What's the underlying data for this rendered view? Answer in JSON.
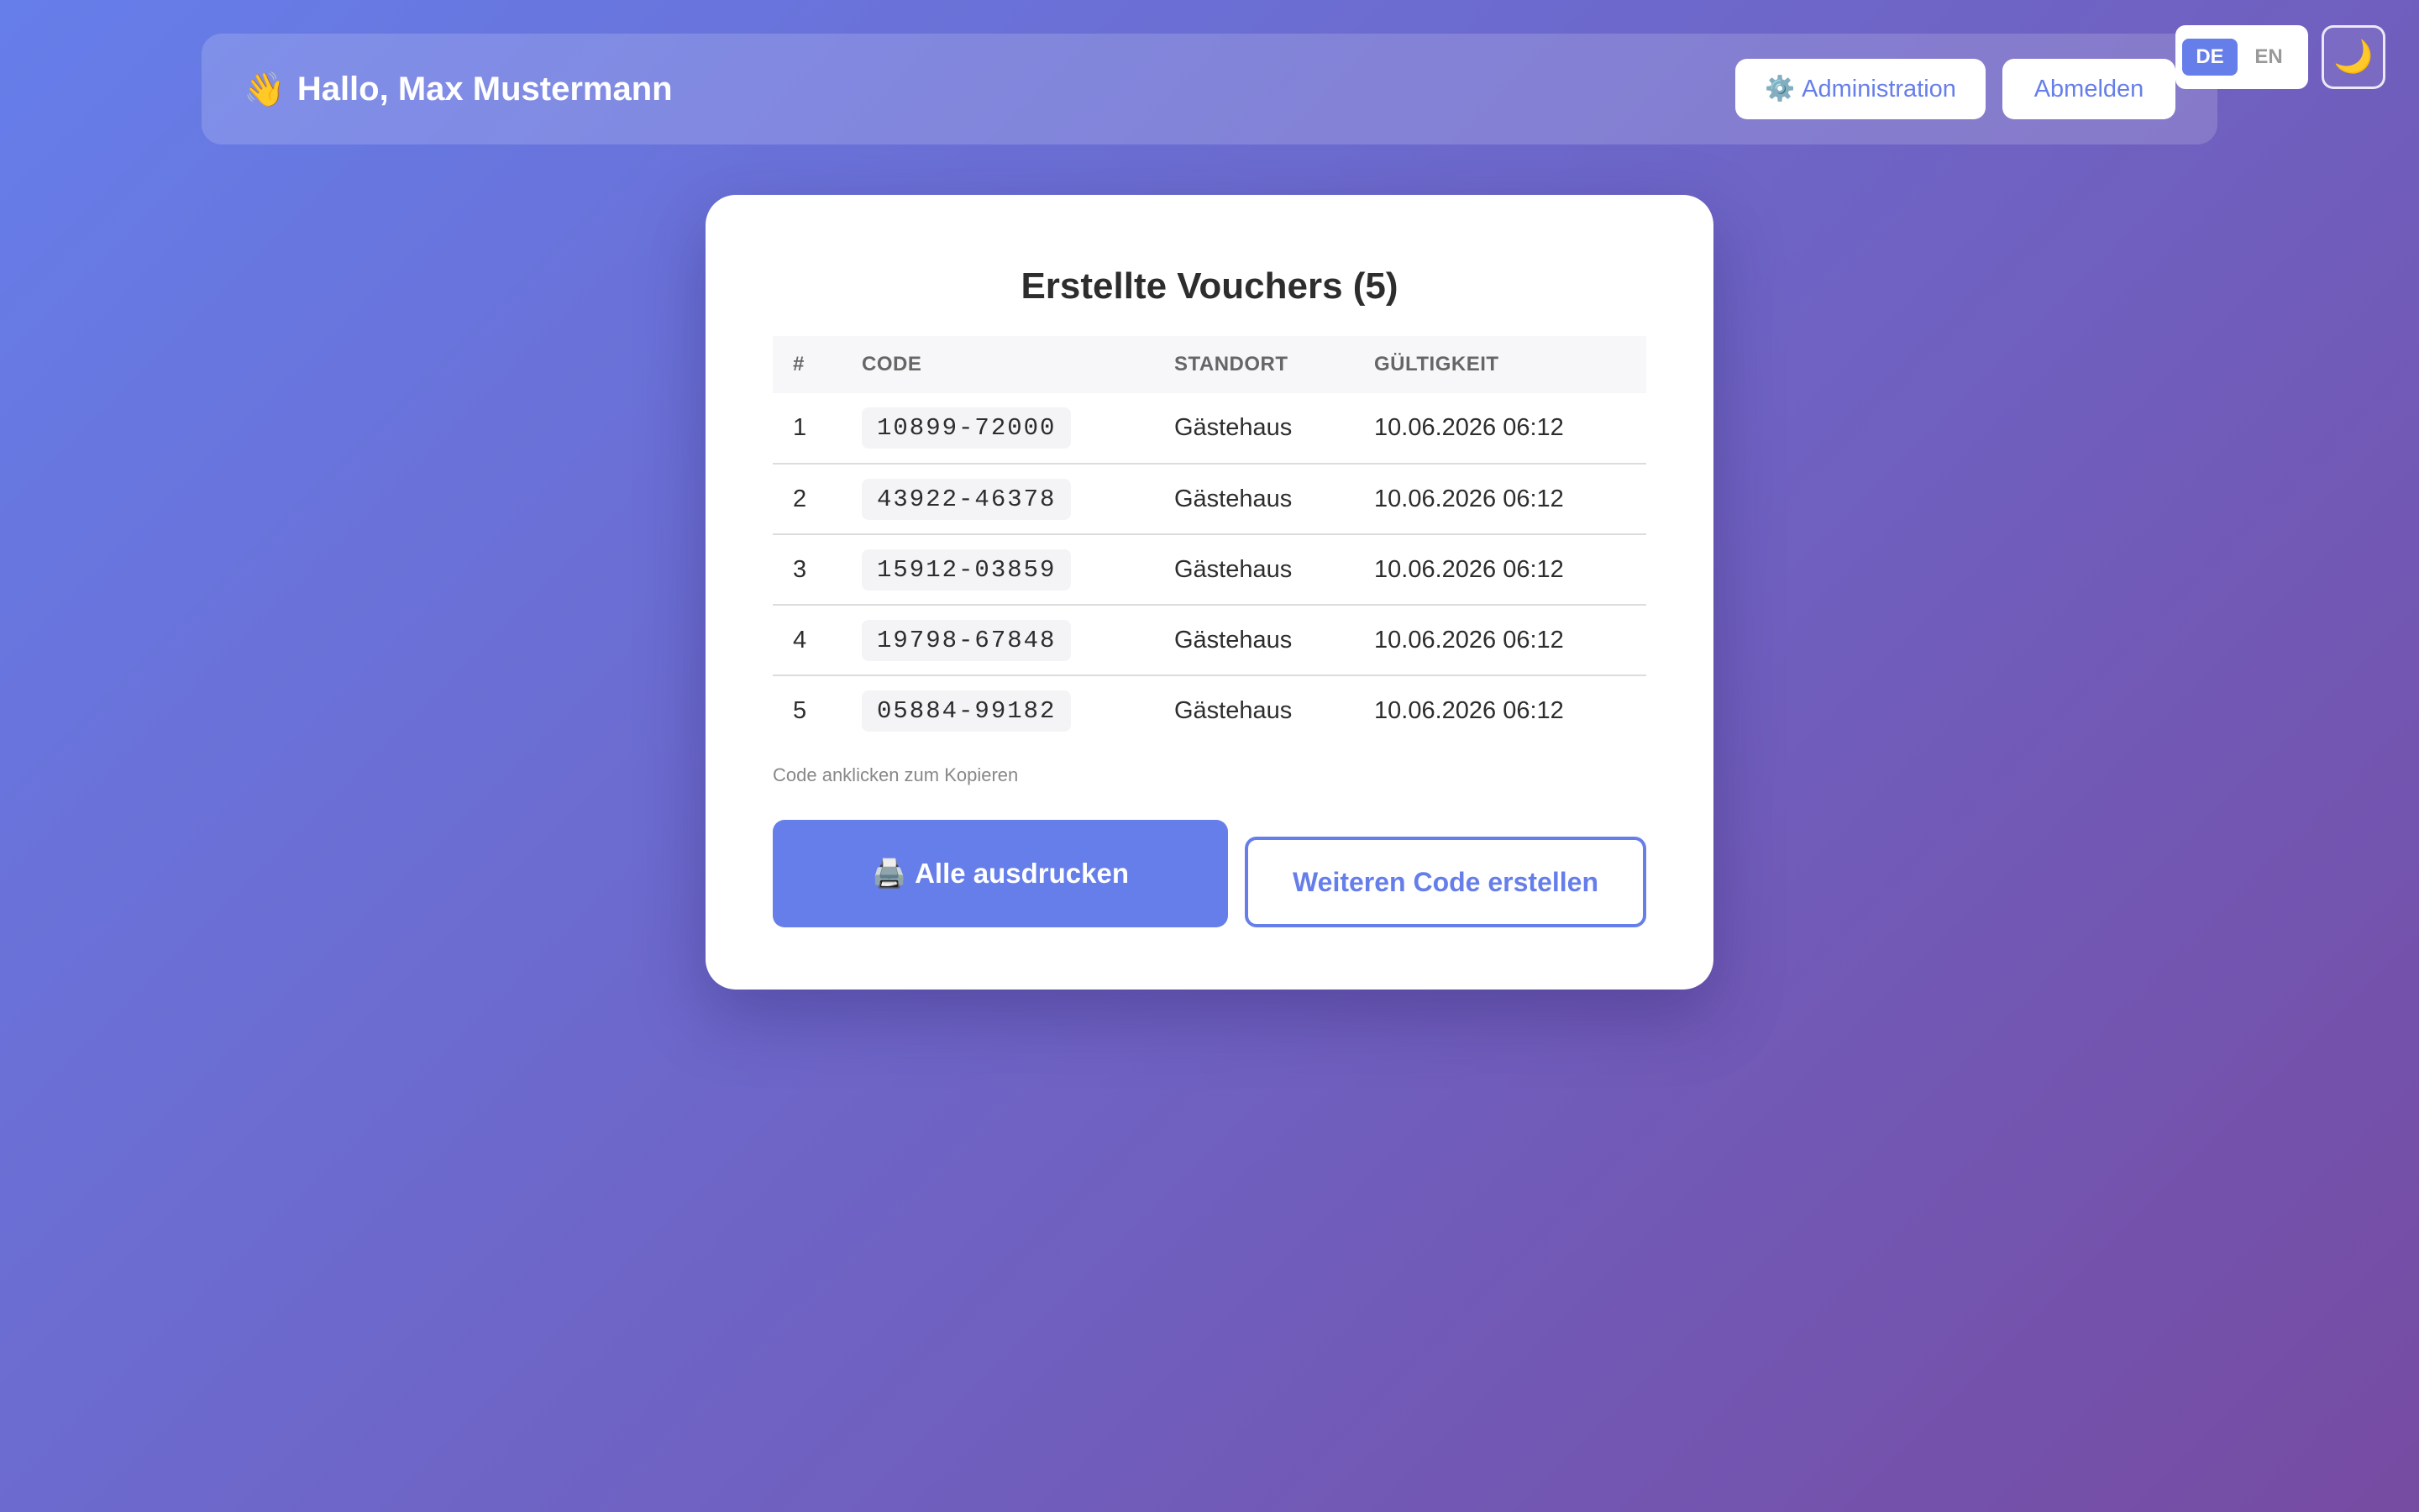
{
  "header": {
    "greeting_icon": "👋",
    "greeting": "Hallo, Max Mustermann",
    "admin_icon": "⚙️",
    "admin_label": "Administration",
    "logout_label": "Abmelden"
  },
  "language": {
    "options": [
      "DE",
      "EN"
    ],
    "active": "DE"
  },
  "theme_toggle": {
    "icon": "🌙",
    "icon_name": "moon-icon"
  },
  "card": {
    "title": "Erstellte Vouchers (5)",
    "columns": [
      "#",
      "CODE",
      "STANDORT",
      "GÜLTIGKEIT"
    ],
    "rows": [
      {
        "num": "1",
        "code": "10899-72000",
        "location": "Gästehaus",
        "validity": "10.06.2026 06:12"
      },
      {
        "num": "2",
        "code": "43922-46378",
        "location": "Gästehaus",
        "validity": "10.06.2026 06:12"
      },
      {
        "num": "3",
        "code": "15912-03859",
        "location": "Gästehaus",
        "validity": "10.06.2026 06:12"
      },
      {
        "num": "4",
        "code": "19798-67848",
        "location": "Gästehaus",
        "validity": "10.06.2026 06:12"
      },
      {
        "num": "5",
        "code": "05884-99182",
        "location": "Gästehaus",
        "validity": "10.06.2026 06:12"
      }
    ],
    "hint": "Code anklicken zum Kopieren",
    "print_icon": "🖨️",
    "print_label": "Alle ausdrucken",
    "more_label": "Weiteren Code erstellen"
  },
  "colors": {
    "accent": "#667eea",
    "gradient_start": "#667eea",
    "gradient_end": "#764ba2"
  }
}
